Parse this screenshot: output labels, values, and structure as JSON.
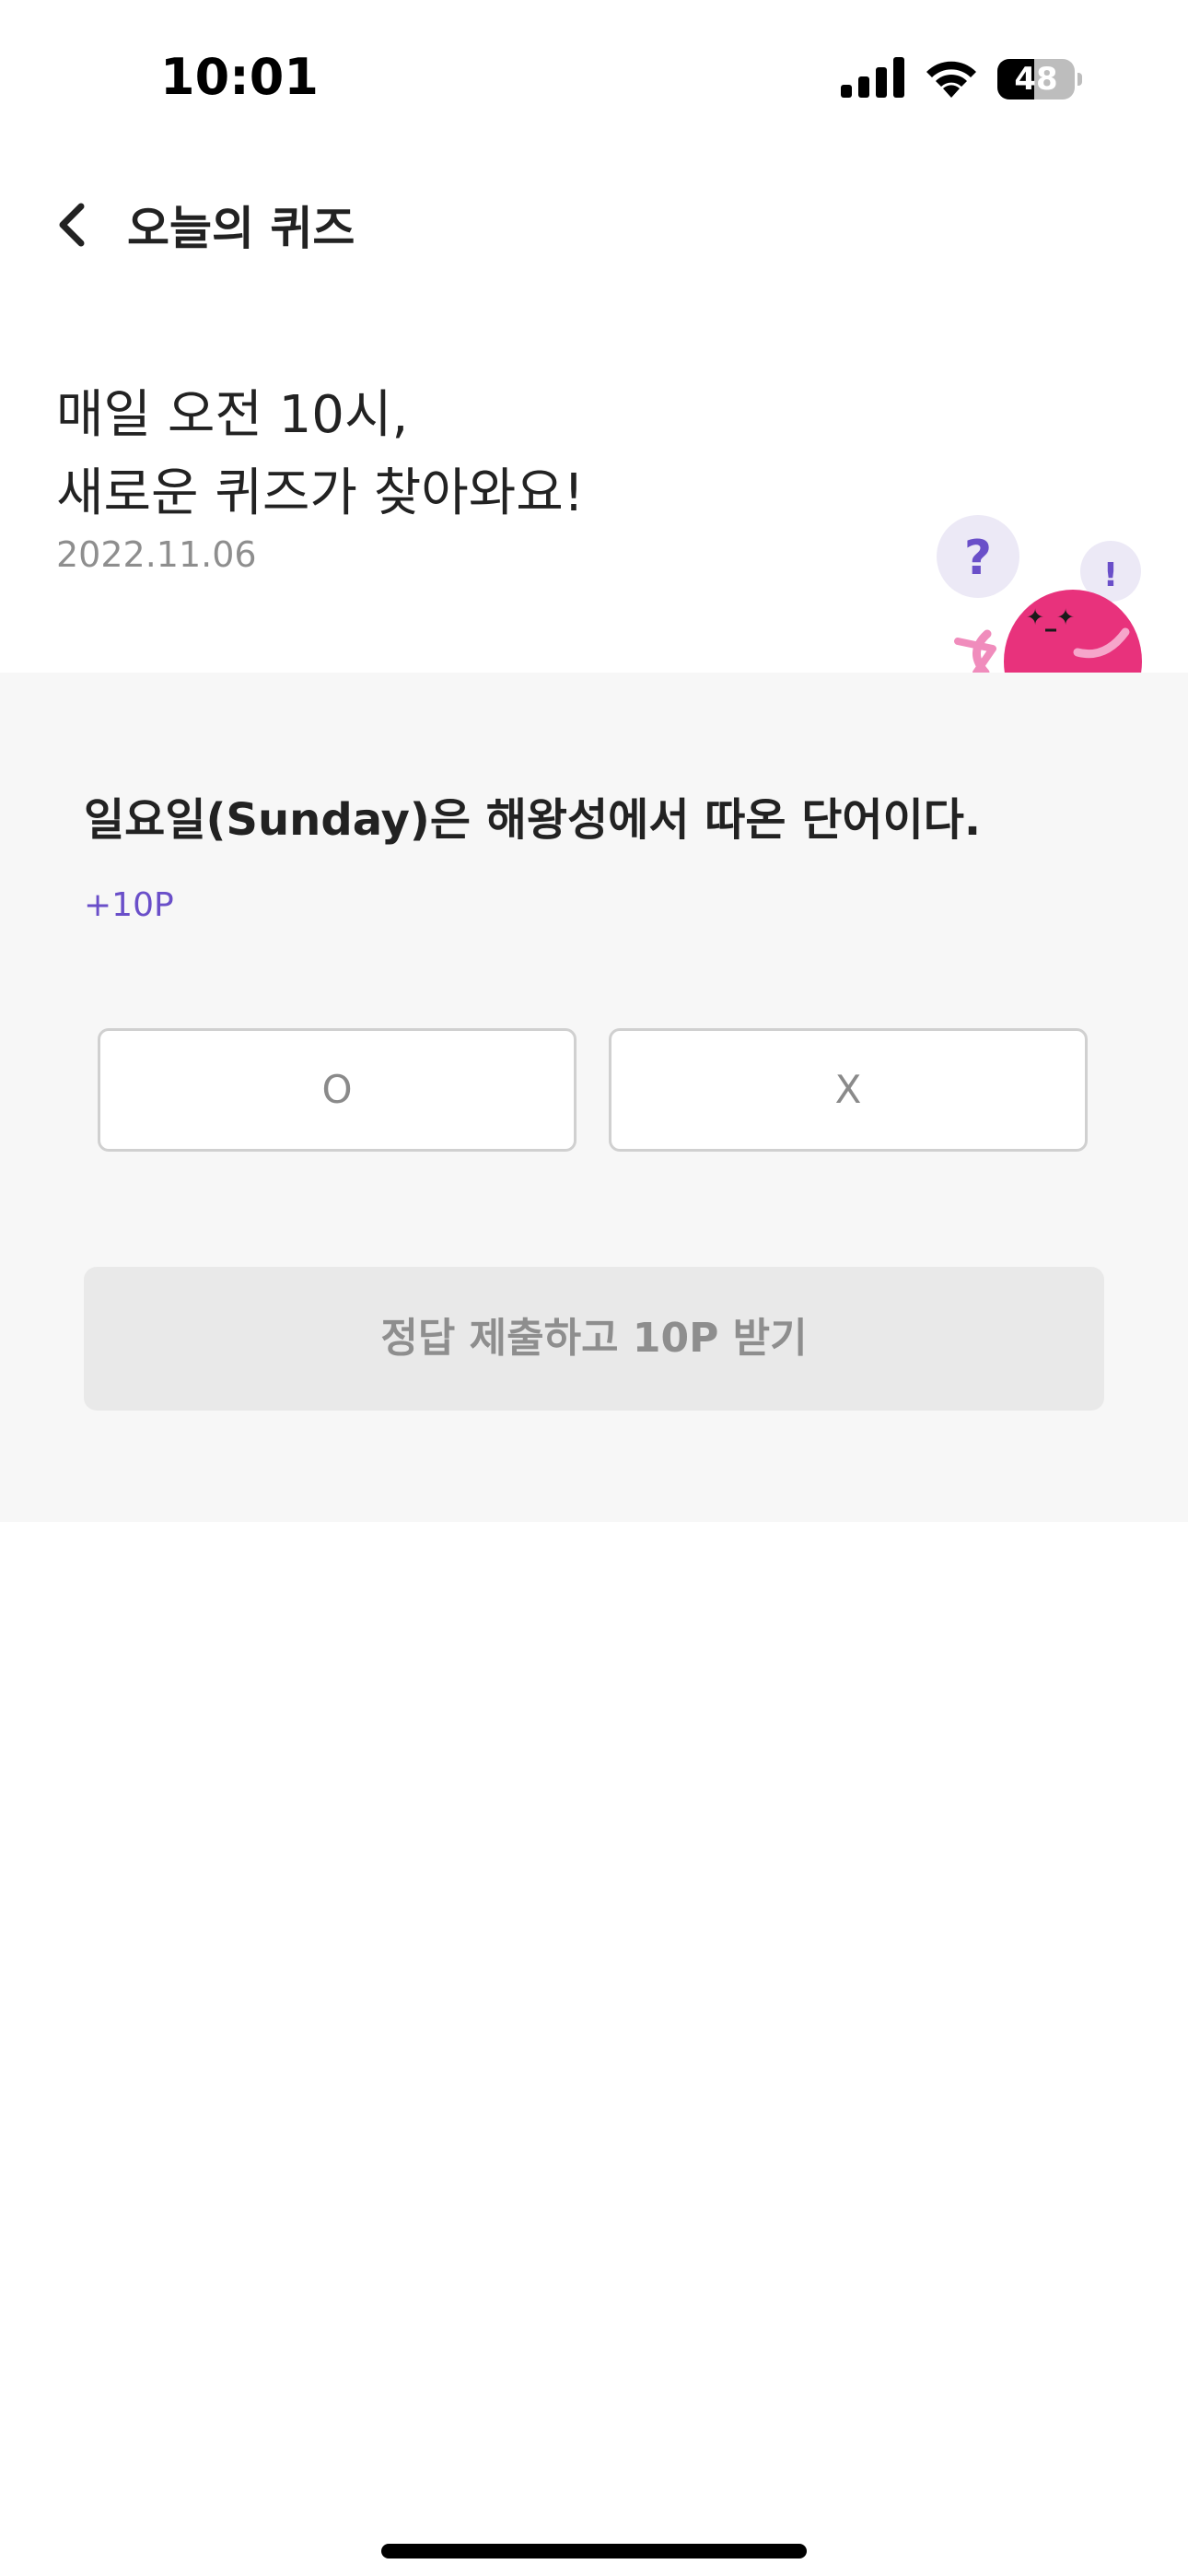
{
  "status_bar": {
    "time": "10:01",
    "battery_percent": "48",
    "battery_level": 0.48,
    "icons": [
      "signal-icon",
      "wifi-icon",
      "battery-icon"
    ]
  },
  "header": {
    "title": "오늘의 퀴즈",
    "back_icon": "chevron-left-icon"
  },
  "intro": {
    "line1": "매일 오전 10시,",
    "line2": "새로운 퀴즈가 찾아와요!",
    "date": "2022.11.06",
    "mascot_icon": "quiz-mascot-icon"
  },
  "quiz": {
    "question": "일요일(Sunday)은 해왕성에서 따온 단어이다.",
    "reward": "+10P",
    "options": [
      {
        "label": "O"
      },
      {
        "label": "X"
      }
    ],
    "submit_label": "정답 제출하고 10P 받기"
  },
  "colors": {
    "accent_purple": "#6a4fc9",
    "mascot_pink": "#e8327c",
    "quiz_background": "#f7f7f7",
    "submit_disabled_bg": "#e9e9e9"
  }
}
